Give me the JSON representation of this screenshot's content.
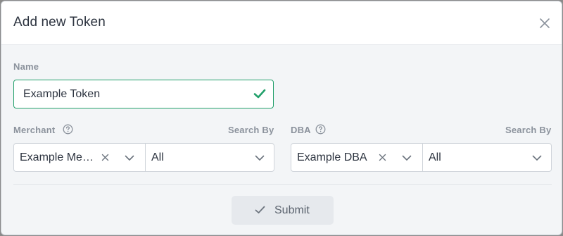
{
  "modal": {
    "title": "Add new Token",
    "close_icon": "close-icon"
  },
  "name_field": {
    "label": "Name",
    "value": "Example Token",
    "valid": true,
    "status_icon": "checkmark-icon",
    "accent_color": "#22a06b"
  },
  "merchant": {
    "label": "Merchant",
    "search_by_label": "Search By",
    "value": "Example Merchant",
    "display_value": "Example Mer…",
    "search_by_value": "All"
  },
  "dba": {
    "label": "DBA",
    "search_by_label": "Search By",
    "value": "Example DBA",
    "search_by_value": "All"
  },
  "footer": {
    "submit_label": "Submit",
    "submit_icon": "checkmark-icon"
  }
}
